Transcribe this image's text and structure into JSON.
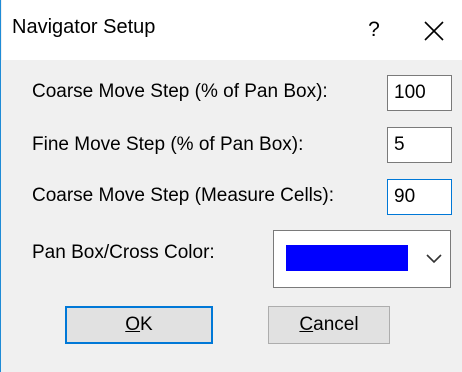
{
  "window": {
    "title": "Navigator Setup",
    "help_label": "?",
    "close_icon": "close-icon"
  },
  "fields": {
    "coarse_pan": {
      "label": "Coarse Move Step (% of Pan Box):",
      "value": "100"
    },
    "fine_pan": {
      "label": "Fine Move Step (% of Pan Box):",
      "value": "5"
    },
    "coarse_cells": {
      "label": "Coarse Move Step (Measure Cells):",
      "value": "90"
    },
    "color": {
      "label": "Pan Box/Cross Color:",
      "value": "#0000ff"
    }
  },
  "buttons": {
    "ok": {
      "mnemonic": "O",
      "rest": "K"
    },
    "cancel": {
      "mnemonic": "C",
      "rest": "ancel"
    }
  },
  "colors": {
    "accent": "#0078d7",
    "window_border": "#1e8bd6",
    "dialog_bg": "#f0f0f0",
    "button_bg": "#e1e1e1"
  }
}
